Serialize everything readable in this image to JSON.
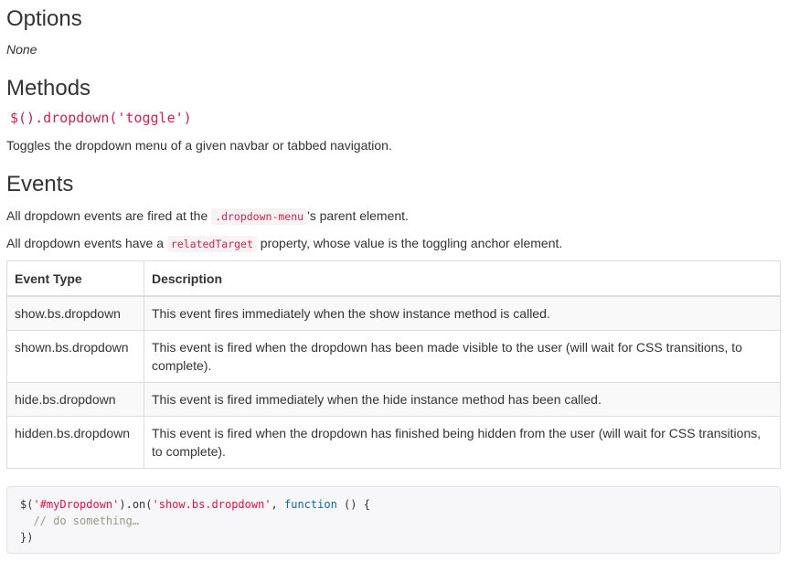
{
  "options": {
    "heading": "Options",
    "value": "None"
  },
  "methods": {
    "heading": "Methods",
    "signature": "$().dropdown('toggle')",
    "description": "Toggles the dropdown menu of a given navbar or tabbed navigation."
  },
  "events": {
    "heading": "Events",
    "p1_before": "All dropdown events are fired at the ",
    "p1_code": ".dropdown-menu",
    "p1_after": "'s parent element.",
    "p2_before": "All dropdown events have a ",
    "p2_code": "relatedTarget",
    "p2_after": " property, whose value is the toggling anchor element.",
    "table": {
      "headers": [
        "Event Type",
        "Description"
      ],
      "rows": [
        [
          "show.bs.dropdown",
          "This event fires immediately when the show instance method is called."
        ],
        [
          "shown.bs.dropdown",
          "This event is fired when the dropdown has been made visible to the user (will wait for CSS transitions, to complete)."
        ],
        [
          "hide.bs.dropdown",
          "This event is fired immediately when the hide instance method has been called."
        ],
        [
          "hidden.bs.dropdown",
          "This event is fired when the dropdown has finished being hidden from the user (will wait for CSS transitions, to complete)."
        ]
      ]
    }
  },
  "code_example": {
    "l1_a": "$(",
    "l1_str1": "'#myDropdown'",
    "l1_b": ").on(",
    "l1_str2": "'show.bs.dropdown'",
    "l1_c": ", ",
    "l1_kw": "function",
    "l1_d": " () {",
    "l2_comment": "  // do something…",
    "l3": "})"
  },
  "colors": {
    "code_text": "#c7254e",
    "code_bg": "#f9f2f4",
    "table_border": "#dddddd",
    "stripe": "#f9f9f9",
    "pre_bg": "#f7f7f9"
  }
}
